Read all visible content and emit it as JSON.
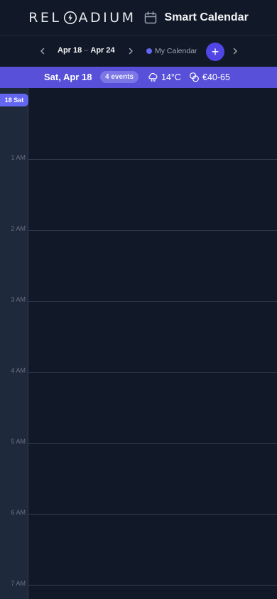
{
  "header": {
    "logo_left": "REL",
    "logo_right": "ADIUM",
    "title": "Smart Calendar"
  },
  "nav": {
    "range_start": "Apr 18",
    "range_sep": "–",
    "range_end": "Apr 24",
    "calendar_name": "My Calendar",
    "add_symbol": "+"
  },
  "banner": {
    "day": "Sat, Apr 18",
    "events": "4 events",
    "weather": "14°C",
    "price": "€40-65"
  },
  "grid": {
    "day_chip": "18 Sat",
    "hours": [
      "1 AM",
      "2 AM",
      "3 AM",
      "4 AM",
      "5 AM",
      "6 AM",
      "7 AM"
    ]
  },
  "colors": {
    "accent": "#6366f1",
    "banner": "#5850d8",
    "background": "#111827"
  },
  "icons": {
    "calendar": "calendar-icon",
    "prev": "chevron-left-icon",
    "next": "chevron-right-icon",
    "weather": "rain-cloud-icon",
    "price": "coins-icon"
  }
}
